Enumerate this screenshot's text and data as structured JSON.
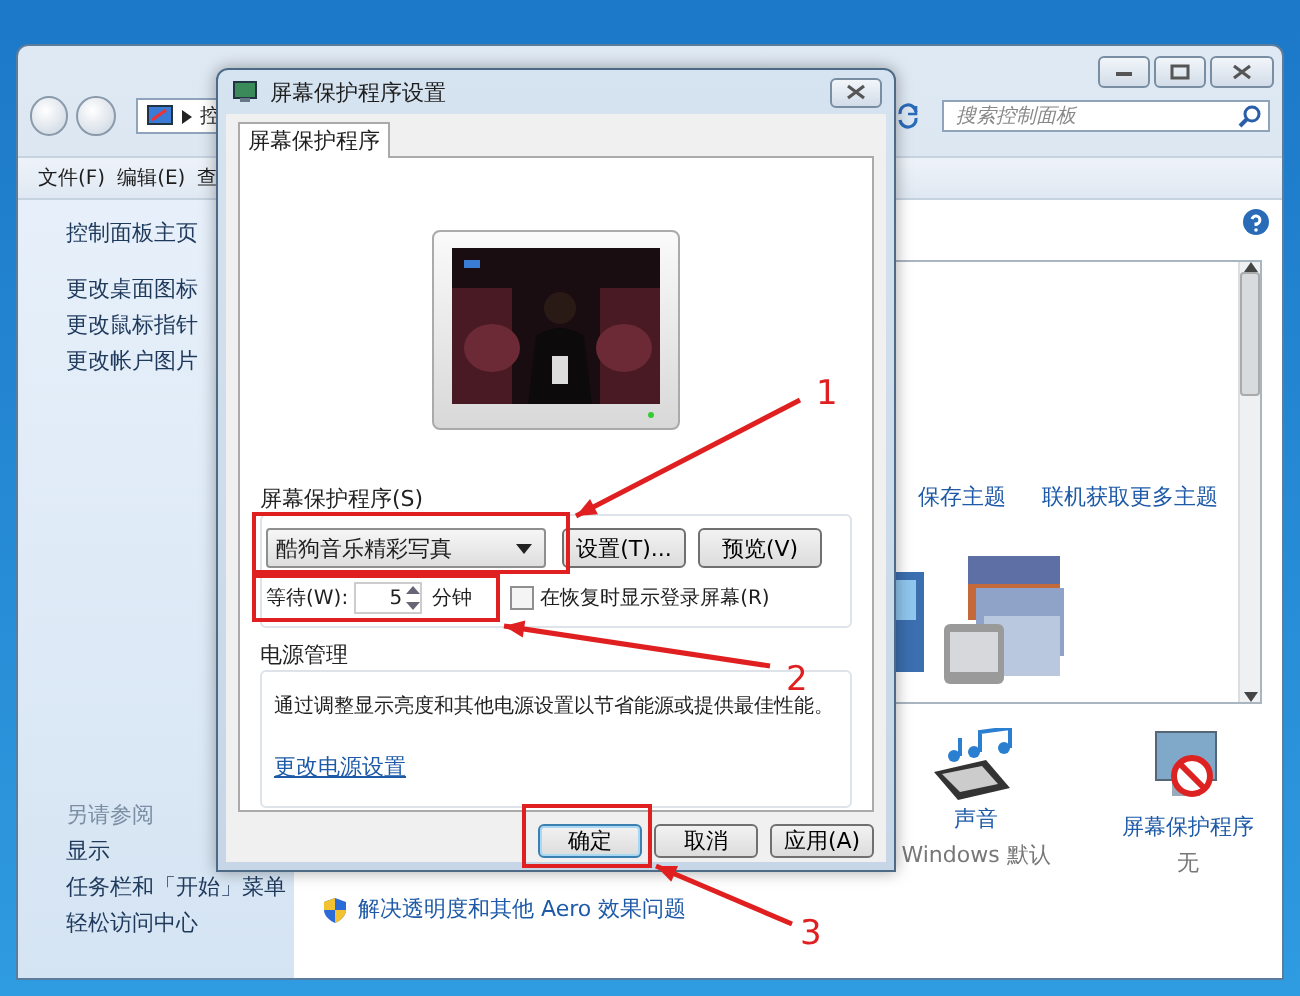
{
  "background_window": {
    "address": "控",
    "search": {
      "placeholder": "搜索控制面板"
    },
    "menu": [
      "文件(F)",
      "编辑(E)",
      "查"
    ],
    "sidebar": {
      "links": [
        "控制面板主页",
        "更改桌面图标",
        "更改鼠标指针",
        "更改帐户图片"
      ],
      "see_also_title": "另请参阅",
      "see_also": [
        "显示",
        "任务栏和「开始」菜单",
        "轻松访问中心"
      ]
    },
    "theme_links": [
      "保存主题",
      "联机获取更多主题"
    ],
    "items": [
      {
        "kind": "sound",
        "label": "声音",
        "value": "Windows 默认"
      },
      {
        "kind": "screensaver",
        "label": "屏幕保护程序",
        "value": "无"
      }
    ],
    "aero_link": "解决透明度和其他 Aero 效果问题"
  },
  "dialog": {
    "title": "屏幕保护程序设置",
    "tabs": [
      {
        "label": "屏幕保护程序",
        "selected": true
      }
    ],
    "screensaver_group": {
      "label": "屏幕保护程序(S)",
      "selected_saver": "酷狗音乐精彩写真",
      "settings_button": "设置(T)...",
      "preview_button": "预览(V)",
      "wait_label": "等待(W):",
      "wait_value": "5",
      "wait_unit": "分钟",
      "resume_checkbox": {
        "label": "在恢复时显示登录屏幕(R)",
        "checked": false
      }
    },
    "power_group": {
      "title": "电源管理",
      "text": "通过调整显示亮度和其他电源设置以节省能源或提供最佳性能。",
      "link": "更改电源设置"
    },
    "buttons": [
      {
        "label": "确定",
        "default": true
      },
      {
        "label": "取消",
        "default": false
      },
      {
        "label": "应用(A)",
        "default": false
      }
    ]
  },
  "annotations": [
    {
      "number": "1"
    },
    {
      "number": "2"
    },
    {
      "number": "3"
    }
  ]
}
